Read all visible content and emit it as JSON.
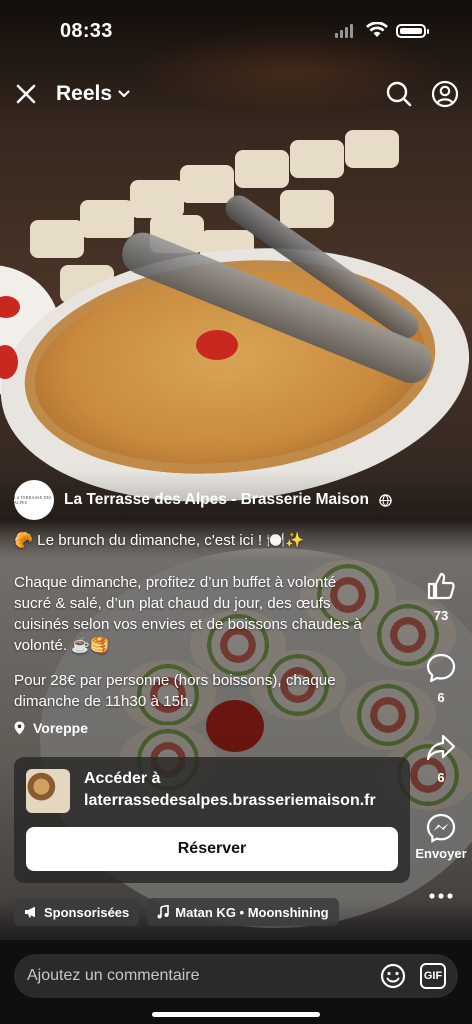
{
  "status_bar": {
    "time": "08:33"
  },
  "header": {
    "title": "Reels"
  },
  "post": {
    "account_name": "La Terrasse des Alpes - Brasserie Maison",
    "avatar_text": "LA TERRASSE DES ALPES",
    "caption_title": "🥐 Le brunch du dimanche, c'est ici ! 🍽️✨",
    "caption_lines": [
      "Chaque dimanche, profitez d’un buffet à volonté",
      "sucré & salé, d’un plat chaud du jour, des œufs",
      "cuisinés selon vos envies et de boissons chaudes à",
      "volonté. ☕🥞"
    ],
    "price_lines": [
      "Pour 28€ par personne (hors boissons), chaque",
      "dimanche de 11h30 à 15h."
    ],
    "location": "Voreppe"
  },
  "link_card": {
    "line1": "Accéder à",
    "line2": "laterrassedesalpes.brasseriemaison.fr",
    "button": "Réserver"
  },
  "chips": {
    "sponsored": "Sponsorisées",
    "music": "Matan KG • Moonshining"
  },
  "rail": {
    "likes": "73",
    "comments": "6",
    "shares": "6",
    "send_label": "Envoyer"
  },
  "comment_bar": {
    "placeholder": "Ajoutez un commentaire",
    "gif": "GIF"
  },
  "icons": [
    "close-icon",
    "chevron-down-icon",
    "search-icon",
    "profile-icon",
    "globe-icon",
    "location-pin-icon",
    "megaphone-icon",
    "music-note-icon",
    "like-icon",
    "comment-icon",
    "share-icon",
    "messenger-icon",
    "more-icon",
    "emoji-icon",
    "gif-icon"
  ]
}
